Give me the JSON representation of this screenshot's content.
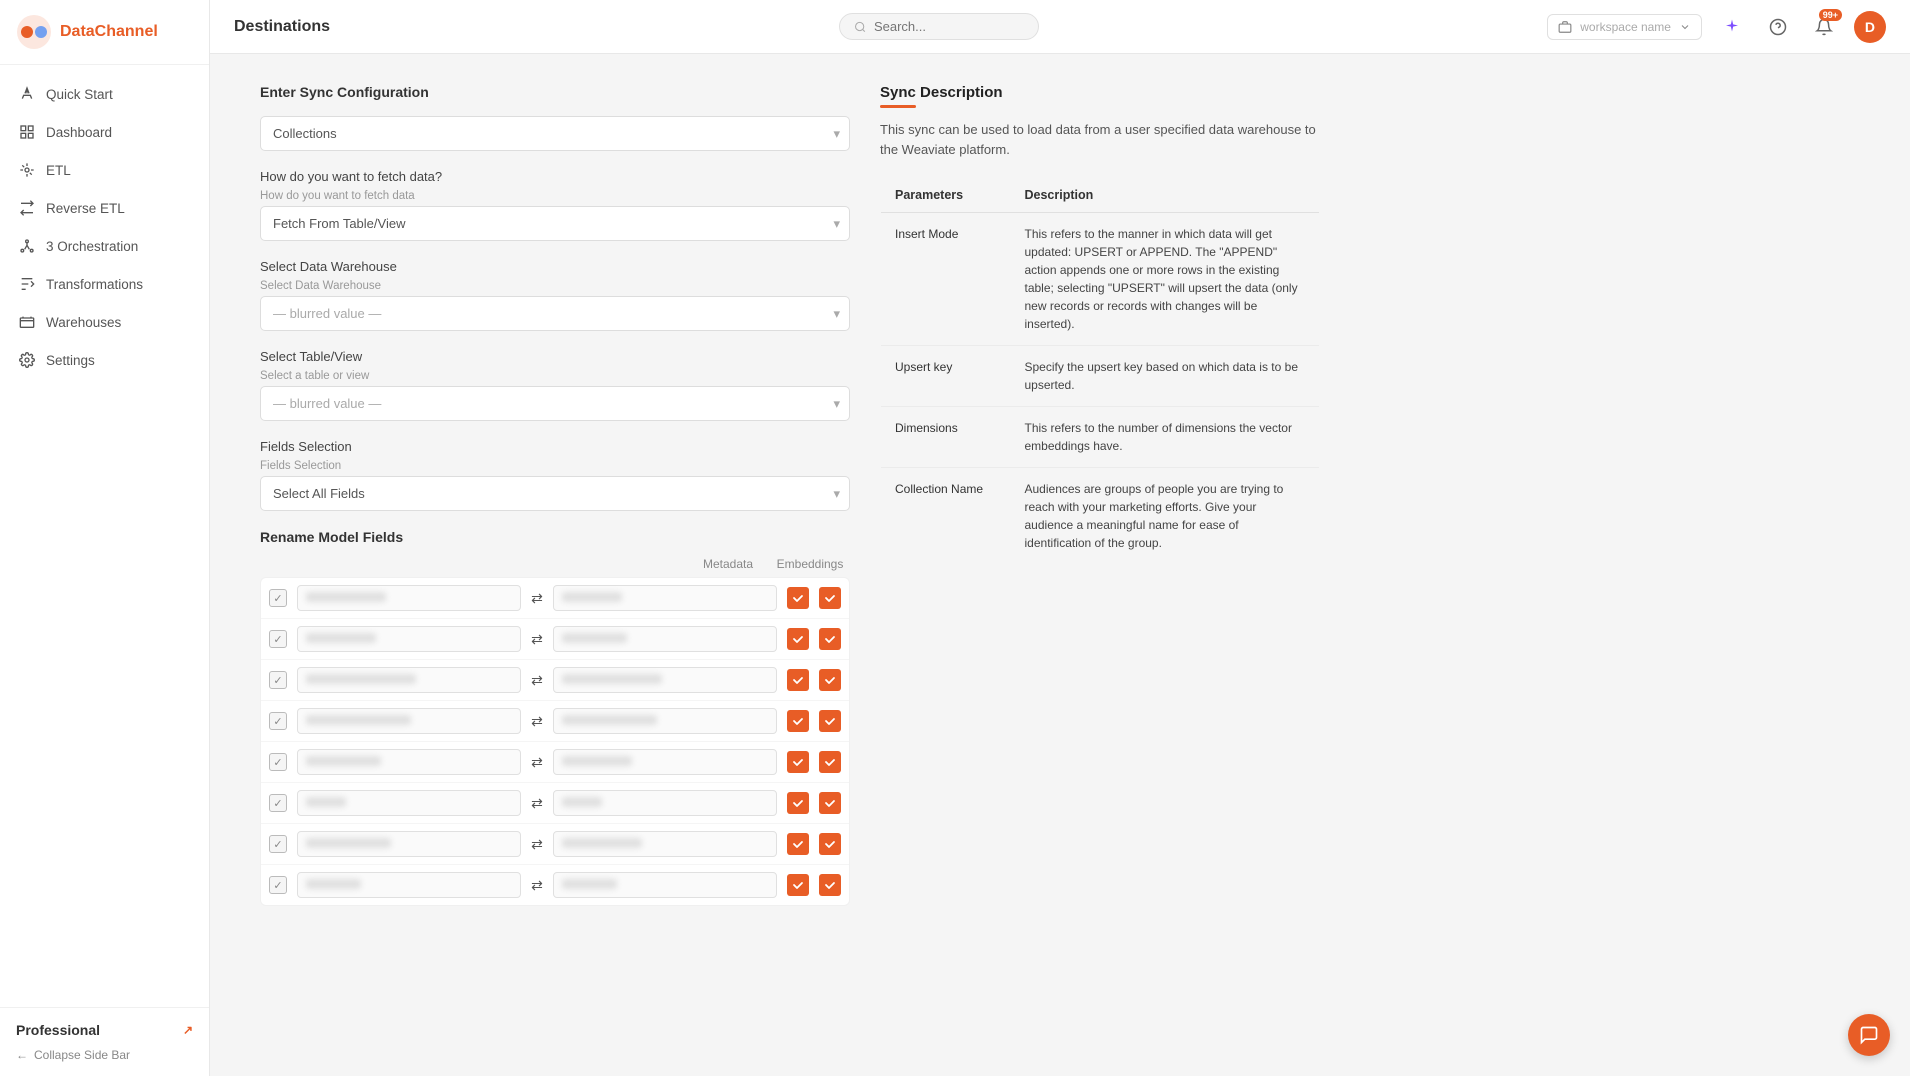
{
  "sidebar": {
    "logo_text": "DataChannel",
    "nav_items": [
      {
        "id": "quickstart",
        "label": "Quick Start",
        "icon": "rocket"
      },
      {
        "id": "dashboard",
        "label": "Dashboard",
        "icon": "grid"
      },
      {
        "id": "etl",
        "label": "ETL",
        "icon": "etl"
      },
      {
        "id": "reverse-etl",
        "label": "Reverse ETL",
        "icon": "reverse-etl"
      },
      {
        "id": "orchestration",
        "label": "Orchestration",
        "icon": "orchestration",
        "badge": "3"
      },
      {
        "id": "transformations",
        "label": "Transformations",
        "icon": "transformations"
      },
      {
        "id": "warehouses",
        "label": "Warehouses",
        "icon": "warehouses"
      },
      {
        "id": "settings",
        "label": "Settings",
        "icon": "settings"
      }
    ],
    "professional_label": "Professional",
    "collapse_label": "Collapse Side Bar"
  },
  "header": {
    "title": "Destinations",
    "search_placeholder": "Search...",
    "workspace_label": "workspace name",
    "notification_badge": "99+",
    "avatar_initial": "D"
  },
  "main": {
    "left": {
      "sync_config_title": "Enter Sync Configuration",
      "collections_placeholder": "Collections",
      "fetch_data_question": "How do you want to fetch data?",
      "fetch_data_label": "How do you want to fetch data",
      "fetch_data_value": "Fetch From Table/View",
      "select_warehouse_label": "Select Data Warehouse",
      "select_warehouse_placeholder": "Select Data Warehouse",
      "select_table_label": "Select Table/View",
      "select_table_placeholder": "Select a table or view",
      "fields_selection_label": "Fields Selection",
      "fields_selection_placeholder": "Fields Selection",
      "fields_selection_value": "Select All Fields",
      "rename_model_fields": "Rename Model Fields",
      "col_metadata": "Metadata",
      "col_embeddings": "Embeddings",
      "field_rows": [
        {
          "input": "row1_in",
          "output": "row1_out",
          "meta": true,
          "embed": true
        },
        {
          "input": "row2_in",
          "output": "row2_out",
          "meta": true,
          "embed": true
        },
        {
          "input": "row3_in",
          "output": "row3_out",
          "meta": true,
          "embed": true
        },
        {
          "input": "row4_in",
          "output": "row4_out",
          "meta": true,
          "embed": true
        },
        {
          "input": "row5_in",
          "output": "row5_out",
          "meta": true,
          "embed": true
        },
        {
          "input": "row6_in",
          "output": "row6_out",
          "meta": true,
          "embed": true
        },
        {
          "input": "row7_in",
          "output": "row7_out",
          "meta": true,
          "embed": true
        },
        {
          "input": "row8_in",
          "output": "row8_out",
          "meta": true,
          "embed": true
        }
      ]
    },
    "right": {
      "sync_desc_title": "Sync Description",
      "sync_desc_text": "This sync can be used to load data from a user specified data warehouse to the Weaviate platform.",
      "params_header_param": "Parameters",
      "params_header_desc": "Description",
      "params": [
        {
          "name": "Insert Mode",
          "desc": "This refers to the manner in which data will get updated: UPSERT or APPEND. The \"APPEND\" action appends one or more rows in the existing table; selecting \"UPSERT\" will upsert the data (only new records or records with changes will be inserted)."
        },
        {
          "name": "Upsert key",
          "desc": "Specify the upsert key based on which data is to be upserted."
        },
        {
          "name": "Dimensions",
          "desc": "This refers to the number of dimensions the vector embeddings have."
        },
        {
          "name": "Collection Name",
          "desc": "Audiences are groups of people you are trying to reach with your marketing efforts. Give your audience a meaningful name for ease of identification of the group."
        }
      ]
    }
  }
}
